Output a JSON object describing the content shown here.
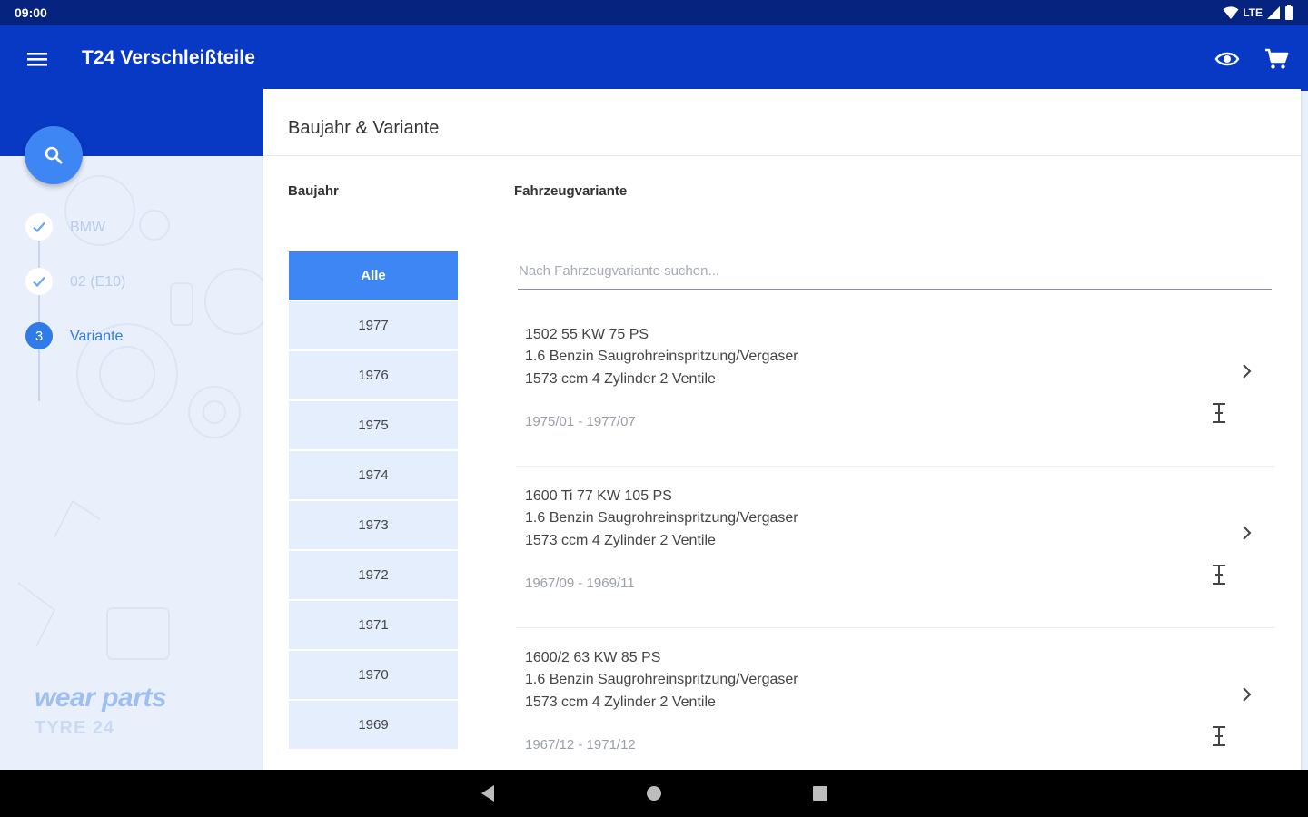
{
  "status_bar": {
    "time": "09:00",
    "network": "LTE"
  },
  "app_bar": {
    "title": "T24 Verschleißteile",
    "icons": [
      "menu-icon",
      "eye-icon",
      "cart-icon"
    ]
  },
  "sidebar": {
    "search_icon": "search-icon",
    "steps": [
      {
        "label": "BMW",
        "state": "done"
      },
      {
        "label": "02 (E10)",
        "state": "done"
      },
      {
        "label": "Variante",
        "state": "active",
        "number": "3"
      }
    ],
    "brand": {
      "line1": "wear parts",
      "line2": "TYRE 24"
    }
  },
  "card": {
    "title": "Baujahr & Variante",
    "year_header": "Baujahr",
    "variant_header": "Fahrzeugvariante",
    "search_placeholder": "Nach Fahrzeugvariante suchen...",
    "years": [
      "Alle",
      "1977",
      "1976",
      "1975",
      "1974",
      "1973",
      "1972",
      "1971",
      "1970",
      "1969"
    ],
    "selected_year": "Alle",
    "variants": [
      {
        "line1": "1502 55 KW 75 PS",
        "line2": "1.6 Benzin Saugrohreinspritzung/Vergaser",
        "line3": "1573 ccm 4 Zylinder 2 Ventile",
        "range": "1975/01 - 1977/07"
      },
      {
        "line1": "1600 Ti 77 KW 105 PS",
        "line2": "1.6 Benzin Saugrohreinspritzung/Vergaser",
        "line3": "1573 ccm 4 Zylinder 2 Ventile",
        "range": "1967/09 - 1969/11"
      },
      {
        "line1": "1600/2 63 KW 85 PS",
        "line2": "1.6 Benzin Saugrohreinspritzung/Vergaser",
        "line3": "1573 ccm 4 Zylinder 2 Ventile",
        "range": "1967/12 - 1971/12"
      }
    ]
  },
  "colors": {
    "status_bar": "#06237f",
    "app_bar": "#0739c4",
    "accent": "#3d86f3",
    "year_bg": "#e4eefc",
    "panel_bg": "#e9f0fb"
  },
  "nav_bar": {
    "icons": [
      "back-icon",
      "home-icon",
      "recents-icon"
    ]
  }
}
